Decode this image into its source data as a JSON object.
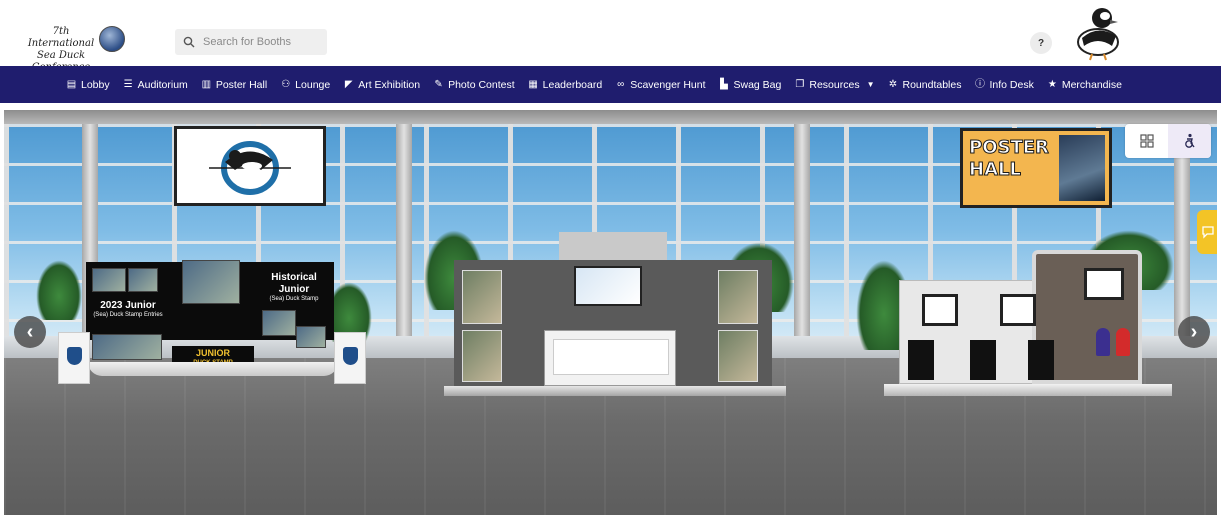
{
  "header": {
    "logo_line1": "7th International",
    "logo_line2": "Sea Duck Conference",
    "search_placeholder": "Search for Booths",
    "help_label": "?"
  },
  "nav": {
    "items": [
      {
        "label": "Lobby",
        "icon": "building-icon"
      },
      {
        "label": "Auditorium",
        "icon": "list-icon"
      },
      {
        "label": "Poster Hall",
        "icon": "poster-icon"
      },
      {
        "label": "Lounge",
        "icon": "chat-icon"
      },
      {
        "label": "Art Exhibition",
        "icon": "palette-icon"
      },
      {
        "label": "Photo Contest",
        "icon": "brush-icon"
      },
      {
        "label": "Leaderboard",
        "icon": "bars-icon"
      },
      {
        "label": "Scavenger Hunt",
        "icon": "binoculars-icon"
      },
      {
        "label": "Swag Bag",
        "icon": "bag-icon"
      },
      {
        "label": "Resources",
        "icon": "copy-icon",
        "has_dropdown": true
      },
      {
        "label": "Roundtables",
        "icon": "asterisk-icon"
      },
      {
        "label": "Info Desk",
        "icon": "info-icon"
      },
      {
        "label": "Merchandise",
        "icon": "star-icon"
      }
    ]
  },
  "scene": {
    "poster_sign_text": "POSTER HALL",
    "booth1": {
      "left_title": "2023 Junior",
      "left_subtitle": "(Sea) Duck Stamp Entries",
      "right_title": "Historical Junior",
      "right_subtitle": "(Sea) Duck Stamp",
      "banner_title": "JUNIOR",
      "banner_subtitle": "DUCK STAMP"
    },
    "colors": {
      "nav_bg": "#1f1d6e",
      "poster_sign": "#f3b64f",
      "chat_tab": "#f3c426"
    }
  }
}
